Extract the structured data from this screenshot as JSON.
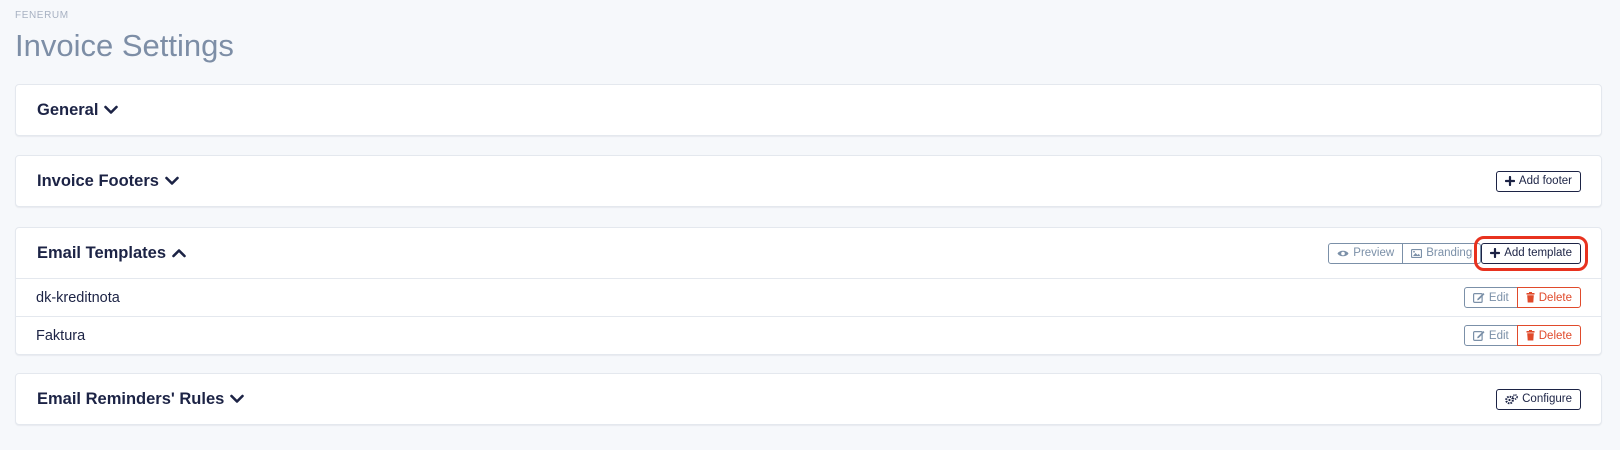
{
  "header": {
    "brand": "FENERUM",
    "title": "Invoice Settings"
  },
  "sections": {
    "general": {
      "title": "General",
      "expanded": false
    },
    "footers": {
      "title": "Invoice Footers",
      "expanded": false,
      "add_label": "Add footer"
    },
    "templates": {
      "title": "Email Templates",
      "expanded": true,
      "preview_label": "Preview",
      "branding_label": "Branding",
      "add_label": "Add template",
      "rows": [
        {
          "name": "dk-kreditnota",
          "edit_label": "Edit",
          "delete_label": "Delete"
        },
        {
          "name": "Faktura",
          "edit_label": "Edit",
          "delete_label": "Delete"
        }
      ]
    },
    "reminders": {
      "title": "Email Reminders' Rules",
      "expanded": false,
      "configure_label": "Configure"
    }
  },
  "colors": {
    "primary": "#1c2345",
    "muted": "#7b90a8",
    "danger": "#e04a2b",
    "highlight": "#e8321f",
    "background": "#f6f8fb"
  },
  "icons": [
    "chevron-down-icon",
    "chevron-up-icon",
    "plus-icon",
    "eye-icon",
    "image-icon",
    "edit-icon",
    "trash-icon",
    "gears-icon"
  ]
}
